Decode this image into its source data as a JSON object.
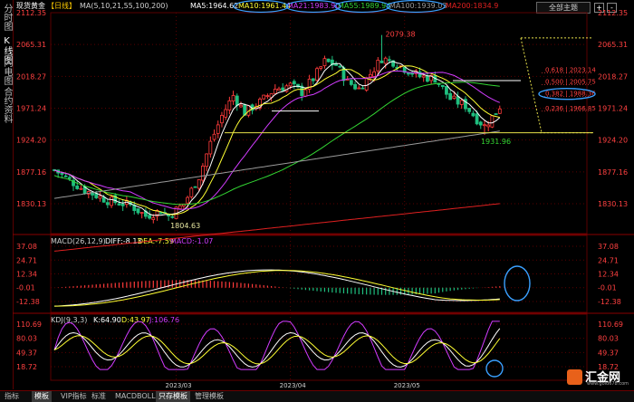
{
  "left_strip": {
    "tabs": [
      {
        "label": "分时图",
        "active": false
      },
      {
        "label": "K线图",
        "active": true
      },
      {
        "label": "闪电图",
        "active": false
      },
      {
        "label": "合约资料",
        "active": false
      }
    ]
  },
  "header": {
    "symbol": "现货黄金",
    "period": "【日线】",
    "ma_params": "MA(5,10,21,55,100,200)",
    "ma5": "MA5:1964.62",
    "ma10": "MA10:1961.44",
    "ma21": "MA21:1983.90",
    "ma55": "MA55:1989.94",
    "ma100": "MA100:1939.03",
    "ma200": "MA200:1834.9",
    "fullscreen_label": "全部主题",
    "zoom_in": "+",
    "zoom_out": "-"
  },
  "macd_header": {
    "title": "MACD(26,12,9)",
    "diff": "DIFF:-8.13",
    "dea": "DEA:-7.59",
    "macd": "MACD:-1.07"
  },
  "kdj_header": {
    "title": "KDJ(9,3,3)",
    "k": "K:64.90",
    "d": "D:43.97",
    "j": "J:106.76"
  },
  "price_axis": [
    "2112.35",
    "2065.31",
    "2018.27",
    "1971.24",
    "1924.20",
    "1877.16",
    "1830.13"
  ],
  "macd_axis": [
    "37.08",
    "24.71",
    "12.34",
    "-0.01",
    "-12.38"
  ],
  "kdj_axis": [
    "110.69",
    "80.03",
    "49.37",
    "18.72"
  ],
  "chart_labels": {
    "high_label": "2079.38",
    "low_label": "1804.63",
    "recent_low_label": "1931.96",
    "fib": [
      {
        "level": "0.618",
        "price": "2023.14",
        "color": "#ff4040"
      },
      {
        "level": "0.500",
        "price": "2005.75",
        "color": "#ff4040"
      },
      {
        "level": "0.382",
        "price": "1988.36",
        "color": "#ff4040"
      },
      {
        "level": "0.236",
        "price": "1966.85",
        "color": "#ff4040"
      }
    ]
  },
  "time_axis": [
    "2023/03",
    "2023/04",
    "2023/05"
  ],
  "watermark": {
    "text": "汇金网",
    "url": "www.gold678.com"
  },
  "bottom_tabs": [
    {
      "label": "指标",
      "active": false
    },
    {
      "label": "模板",
      "active": true
    },
    {
      "label": "VIP指标",
      "active": false
    },
    {
      "label": "标准",
      "active": false
    },
    {
      "label": "MACD",
      "active": false
    },
    {
      "label": "BOLL",
      "active": false
    },
    {
      "label": "只存模板",
      "active": true
    },
    {
      "label": "管理模板",
      "active": false
    }
  ],
  "colors": {
    "up": "#ff3b3b",
    "down": "#1fbf7f",
    "ma5": "#ffffff",
    "ma10": "#ffff33",
    "ma21": "#d23cff",
    "ma55": "#33d633",
    "ma100": "#9a9a9a",
    "ma200": "#e02020",
    "annotation": "#3aa0ff",
    "grid": "#5a0000"
  }
}
